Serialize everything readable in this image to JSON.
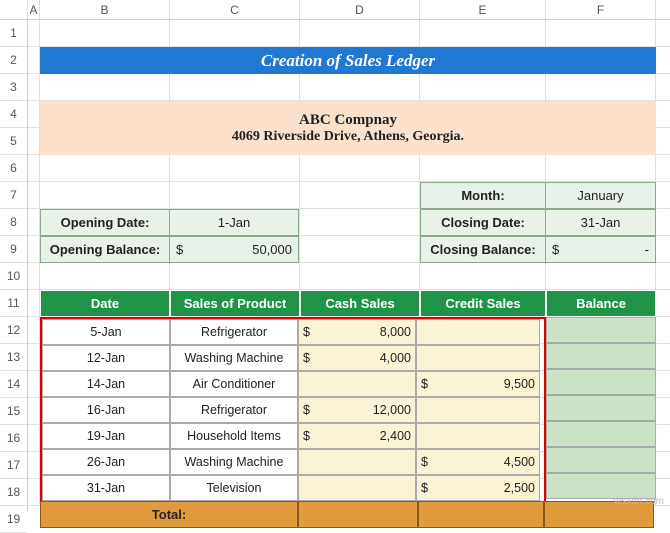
{
  "columns": [
    "A",
    "B",
    "C",
    "D",
    "E",
    "F"
  ],
  "rows": [
    "1",
    "2",
    "3",
    "4",
    "5",
    "6",
    "7",
    "8",
    "9",
    "10",
    "11",
    "12",
    "13",
    "14",
    "15",
    "16",
    "17",
    "18",
    "19"
  ],
  "title": "Creation of Sales Ledger",
  "company": {
    "name": "ABC Compnay",
    "address": "4069 Riverside Drive, Athens, Georgia."
  },
  "opening": {
    "date_label": "Opening Date:",
    "date_value": "1-Jan",
    "balance_label": "Opening Balance:",
    "balance_prefix": "$",
    "balance_value": "50,000"
  },
  "month": {
    "month_label": "Month:",
    "month_value": "January",
    "close_date_label": "Closing Date:",
    "close_date_value": "31-Jan",
    "close_bal_label": "Closing Balance:",
    "close_bal_prefix": "$",
    "close_bal_value": "-"
  },
  "headers": {
    "date": "Date",
    "product": "Sales of Product",
    "cash": "Cash Sales",
    "credit": "Credit Sales",
    "balance": "Balance"
  },
  "rows_data": [
    {
      "date": "5-Jan",
      "product": "Refrigerator",
      "cash_p": "$",
      "cash": "8,000",
      "credit_p": "",
      "credit": ""
    },
    {
      "date": "12-Jan",
      "product": "Washing Machine",
      "cash_p": "$",
      "cash": "4,000",
      "credit_p": "",
      "credit": ""
    },
    {
      "date": "14-Jan",
      "product": "Air Conditioner",
      "cash_p": "",
      "cash": "",
      "credit_p": "$",
      "credit": "9,500"
    },
    {
      "date": "16-Jan",
      "product": "Refrigerator",
      "cash_p": "$",
      "cash": "12,000",
      "credit_p": "",
      "credit": ""
    },
    {
      "date": "19-Jan",
      "product": "Household Items",
      "cash_p": "$",
      "cash": "2,400",
      "credit_p": "",
      "credit": ""
    },
    {
      "date": "26-Jan",
      "product": "Washing Machine",
      "cash_p": "",
      "cash": "",
      "credit_p": "$",
      "credit": "4,500"
    },
    {
      "date": "31-Jan",
      "product": "Television",
      "cash_p": "",
      "cash": "",
      "credit_p": "$",
      "credit": "2,500"
    }
  ],
  "total_label": "Total:",
  "watermark": "wsxdn.com"
}
